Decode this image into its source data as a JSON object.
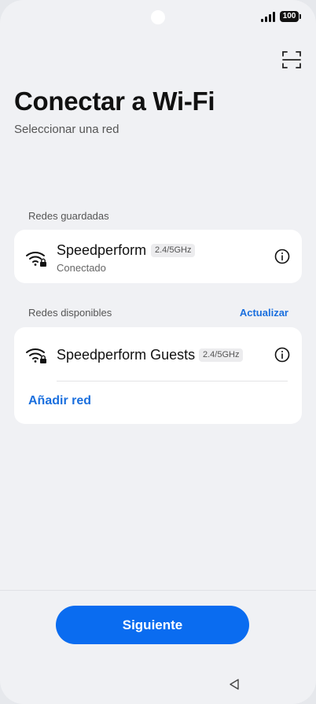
{
  "status_bar": {
    "battery": "100"
  },
  "header": {
    "title": "Conectar a Wi-Fi",
    "subtitle": "Seleccionar una red",
    "scan_icon": "qr-scan-icon"
  },
  "saved": {
    "label": "Redes guardadas",
    "networks": [
      {
        "name": "Speedperform",
        "band": "2.4/5GHz",
        "status": "Conectado",
        "icon": "wifi-locked-icon"
      }
    ]
  },
  "available": {
    "label": "Redes disponibles",
    "refresh_label": "Actualizar",
    "networks": [
      {
        "name": "Speedperform Guests",
        "band": "2.4/5GHz",
        "icon": "wifi-locked-icon"
      }
    ],
    "add_label": "Añadir red"
  },
  "footer": {
    "next_label": "Siguiente"
  },
  "colors": {
    "accent": "#0a6cf0",
    "link": "#1a6fde",
    "background": "#f0f1f4"
  }
}
